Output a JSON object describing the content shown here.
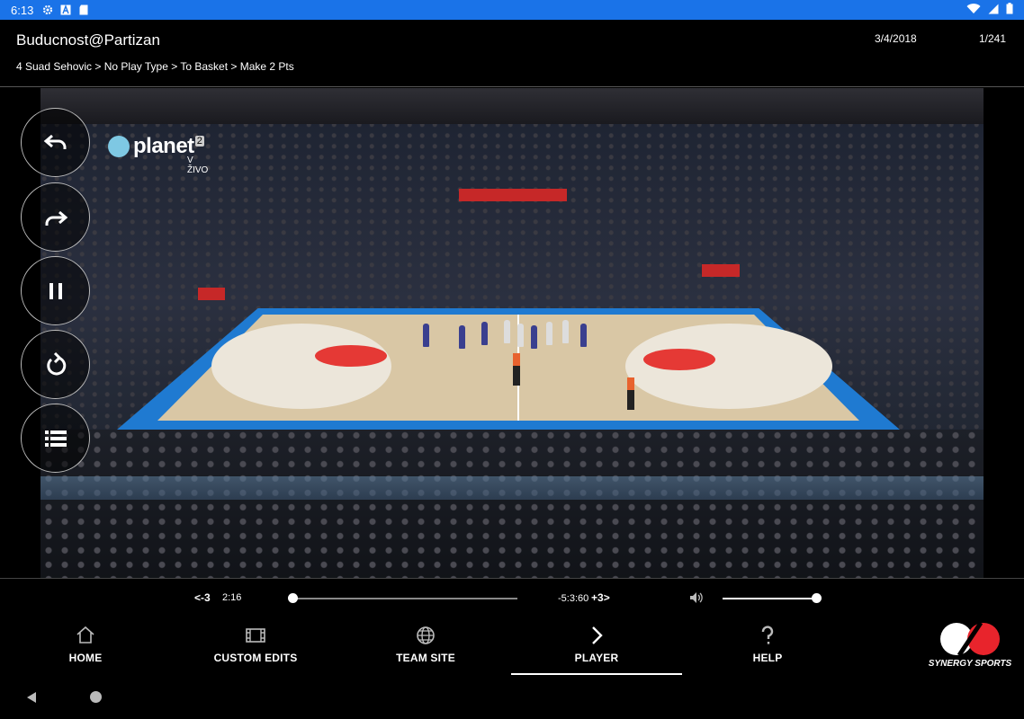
{
  "statusbar": {
    "time": "6:13",
    "icons": [
      "gear-icon",
      "font-icon",
      "sd-card-icon"
    ],
    "right_icons": [
      "wifi-icon",
      "signal-icon",
      "battery-icon"
    ]
  },
  "header": {
    "title": "Buducnost@Partizan",
    "breadcrumb": "4 Suad Sehovic > No Play Type > To Basket > Make 2 Pts",
    "date": "3/4/2018",
    "clip_counter": "1/241"
  },
  "video": {
    "channel_name": "planet",
    "channel_number": "2",
    "channel_sub": "V ŽIVO"
  },
  "side_controls": [
    "rewind-icon",
    "forward-icon",
    "pause-icon",
    "replay-icon",
    "playlist-icon"
  ],
  "playback": {
    "back_label": "-3",
    "elapsed": "2:16",
    "remaining": "-5:3:60",
    "forward_label": "+3",
    "progress": 0.0,
    "volume": 1.0
  },
  "nav": {
    "items": [
      {
        "label": "HOME",
        "icon": "home-icon"
      },
      {
        "label": "CUSTOM EDITS",
        "icon": "film-icon"
      },
      {
        "label": "TEAM SITE",
        "icon": "globe-icon"
      },
      {
        "label": "PLAYER",
        "icon": "chevron-right-icon",
        "active": true
      },
      {
        "label": "HELP",
        "icon": "question-icon"
      }
    ],
    "brand": "SYNERGY SPORTS"
  },
  "colors": {
    "status_bar": "#1a73e8",
    "brand_red": "#e8242c"
  }
}
